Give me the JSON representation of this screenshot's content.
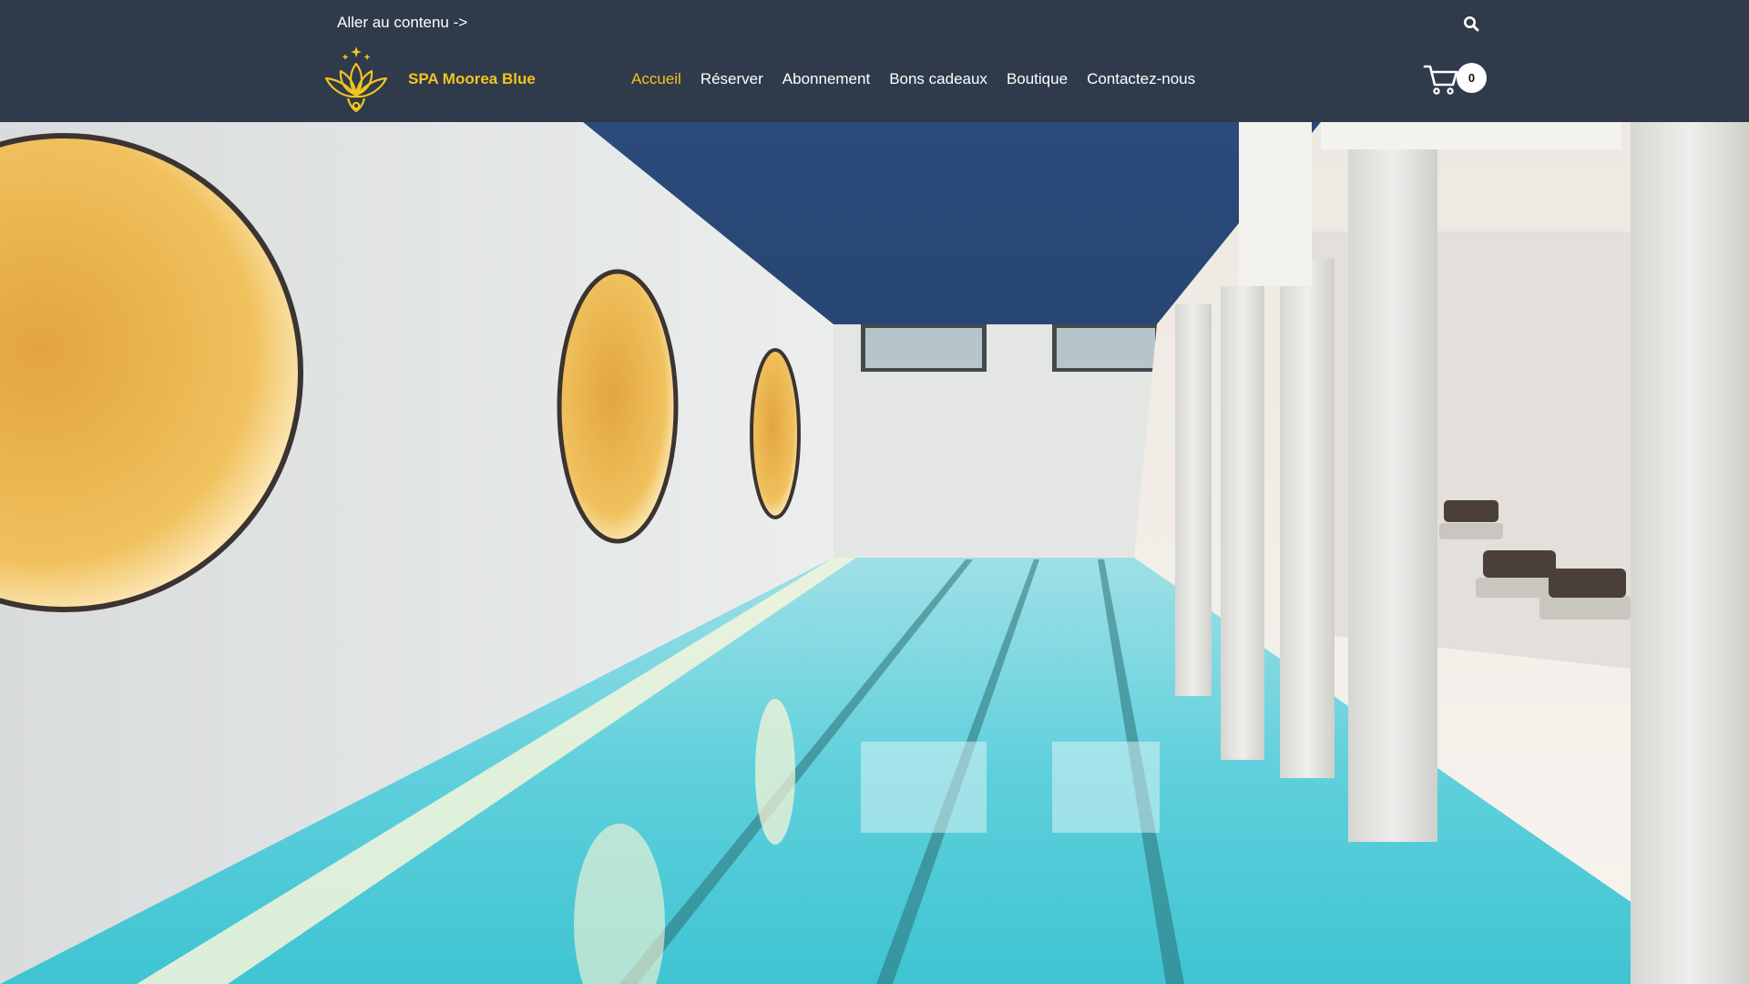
{
  "colors": {
    "header_bg": "#2f3a4a",
    "brand_gold": "#f2c41f",
    "nav_text": "#ffffff",
    "nav_active": "#f2c41f"
  },
  "header": {
    "skip_link": "Aller au contenu ->",
    "search_icon": "search-icon",
    "logo_icon": "lotus-logo-icon",
    "site_title": "SPA Moorea Blue",
    "nav": [
      {
        "label": "Accueil",
        "active": true
      },
      {
        "label": "Réserver",
        "active": false
      },
      {
        "label": "Abonnement",
        "active": false
      },
      {
        "label": "Bons cadeaux",
        "active": false
      },
      {
        "label": "Boutique",
        "active": false
      },
      {
        "label": "Contactez-nous",
        "active": false
      }
    ],
    "cart": {
      "icon": "cart-icon",
      "count": "0"
    }
  },
  "hero": {
    "image": "indoor-pool-photo"
  }
}
